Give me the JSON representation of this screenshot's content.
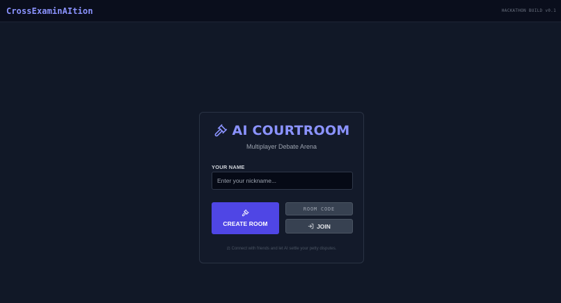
{
  "header": {
    "brand": "CrossExaminAItion",
    "build": "HACKATHON BUILD v0.1"
  },
  "card": {
    "title": "AI COURTROOM",
    "subtitle": "Multiplayer Debate Arena",
    "name_label": "YOUR NAME",
    "name_placeholder": "Enter your nickname...",
    "name_value": "",
    "create_label": "CREATE ROOM",
    "room_code_placeholder": "ROOM CODE",
    "room_code_value": "",
    "join_label": "JOIN",
    "footer": "⚖ Connect with friends and let AI settle your petty disputes."
  },
  "icons": {
    "title_icon": "gavel-icon",
    "create_icon": "gavel-icon",
    "join_icon": "log-in-icon"
  },
  "colors": {
    "accent": "#8b93ff",
    "primary_button": "#4f46e5",
    "background": "#111827",
    "card": "#131a2a"
  }
}
